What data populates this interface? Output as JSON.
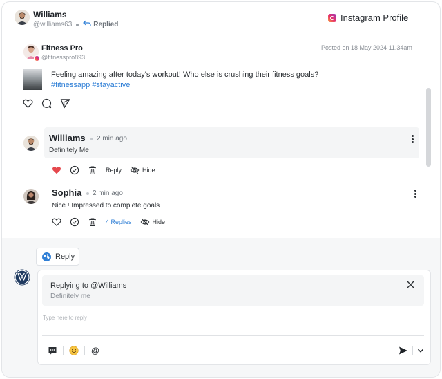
{
  "header": {
    "name": "Williams",
    "handle": "@williams63",
    "status": "Replied",
    "profile_link": "Instagram Profile"
  },
  "post": {
    "author": "Fitness Pro",
    "handle": "@fitnesspro893",
    "posted_on": "Posted on 18 May 2024 11.34am",
    "text": "Feeling amazing after today's workout! Who else is crushing their fitness goals?",
    "tags": "#fitnessapp #stayactive",
    "actions": [
      "heart-icon",
      "comment-icon",
      "send-icon"
    ]
  },
  "comments": [
    {
      "author": "Williams",
      "time": "2 min ago",
      "text": "Definitely Me",
      "liked": true,
      "reply_label": "Reply",
      "hide_label": "Hide"
    },
    {
      "author": "Sophia",
      "time": "2 min ago",
      "text": "Nice ! Impressed to complete goals",
      "liked": false,
      "replies_label": "4 Replies",
      "hide_label": "Hide"
    }
  ],
  "composer": {
    "tab_label": "Reply",
    "replying_to_prefix": "Replying to ",
    "replying_to_user": "@Williams",
    "replying_snippet": "Definitely me",
    "placeholder": "Type here to reply",
    "mention_symbol": "@"
  },
  "colors": {
    "accent": "#2f7fd6",
    "like": "#e5484d",
    "panel": "#f6f7f8"
  }
}
